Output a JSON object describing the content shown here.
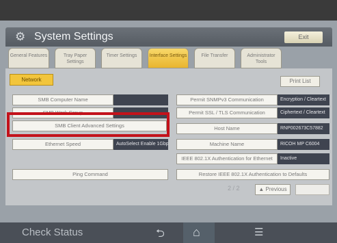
{
  "header": {
    "title": "System Settings",
    "exit_label": "Exit"
  },
  "tabs": [
    {
      "label": "General Features"
    },
    {
      "label": "Tray Paper Settings"
    },
    {
      "label": "Timer Settings"
    },
    {
      "label": "Interface Settings"
    },
    {
      "label": "File Transfer"
    },
    {
      "label": "Administrator Tools"
    }
  ],
  "subtab": {
    "label": "Network",
    "print_list_label": "Print List"
  },
  "left_items": [
    {
      "label": "SMB Computer Name",
      "value": ""
    },
    {
      "label": "SMB Work Group",
      "value": ""
    },
    {
      "label": "SMB Client Advanced Settings",
      "value": ""
    },
    {
      "label": "Ethernet Speed",
      "value": "AutoSelect Enable 1Gbps"
    },
    {
      "label": "Ping Command",
      "value": ""
    }
  ],
  "right_items": [
    {
      "label": "Permit SNMPv3 Communication",
      "value": "Encryption / Cleartext"
    },
    {
      "label": "Permit SSL / TLS Communication",
      "value": "Ciphertext / Cleartext"
    },
    {
      "label": "Host Name",
      "value": "RNP002673C57882"
    },
    {
      "label": "Machine Name",
      "value": "RICOH MP C6004"
    },
    {
      "label": "IEEE 802.1X Authentication for Ethernet",
      "value": "Inactive"
    },
    {
      "label": "Restore IEEE 802.1X Authentication to Defaults",
      "value": ""
    }
  ],
  "pagination": {
    "text": "2 / 2",
    "previous_label": "▲ Previous"
  },
  "footer": {
    "check_status_label": "Check Status"
  },
  "icons": {
    "gear": "gear-icon",
    "back": "back-icon",
    "home": "home-icon",
    "menu": "menu-icon"
  },
  "colors": {
    "highlight": "#c3121b",
    "active_tab": "#f2c53c"
  }
}
